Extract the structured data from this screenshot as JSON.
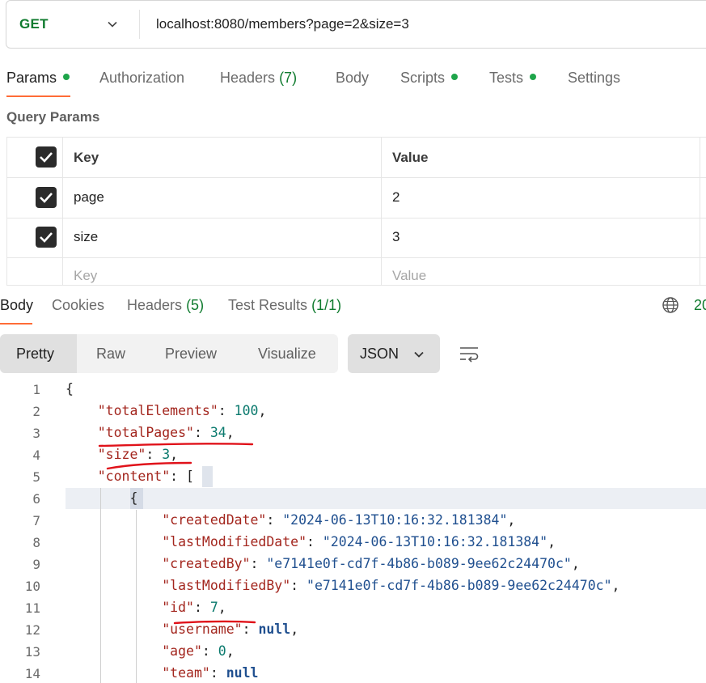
{
  "request": {
    "method": "GET",
    "url": "localhost:8080/members?page=2&size=3",
    "tabs": [
      {
        "label": "Params",
        "dot": true
      },
      {
        "label": "Authorization"
      },
      {
        "label": "Headers",
        "count": "(7)"
      },
      {
        "label": "Body"
      },
      {
        "label": "Scripts",
        "dot": true
      },
      {
        "label": "Tests",
        "dot": true
      },
      {
        "label": "Settings"
      }
    ],
    "query_params_title": "Query Params",
    "table": {
      "header_key": "Key",
      "header_value": "Value",
      "rows": [
        {
          "key": "page",
          "value": "2",
          "checked": true
        },
        {
          "key": "size",
          "value": "3",
          "checked": true
        }
      ],
      "placeholder_key": "Key",
      "placeholder_value": "Value"
    }
  },
  "response": {
    "tabs": [
      {
        "label": "Body"
      },
      {
        "label": "Cookies"
      },
      {
        "label": "Headers",
        "count": "(5)"
      },
      {
        "label": "Test Results",
        "count": "(1/1)"
      }
    ],
    "status_code_partial": "20",
    "view_modes": [
      "Pretty",
      "Raw",
      "Preview",
      "Visualize"
    ],
    "format": "JSON",
    "line_numbers": [
      "1",
      "2",
      "3",
      "4",
      "5",
      "6",
      "7",
      "8",
      "9",
      "10",
      "11",
      "12",
      "13",
      "14"
    ],
    "code": {
      "l1": "{",
      "totalElements_key": "\"totalElements\"",
      "totalElements_val": "100",
      "totalPages_key": "\"totalPages\"",
      "totalPages_val": "34",
      "size_key": "\"size\"",
      "size_val": "3",
      "content_key": "\"content\"",
      "content_open": "[",
      "l6": "{",
      "createdDate_key": "\"createdDate\"",
      "createdDate_val": "\"2024-06-13T10:16:32.181384\"",
      "lastModifiedDate_key": "\"lastModifiedDate\"",
      "lastModifiedDate_val": "\"2024-06-13T10:16:32.181384\"",
      "createdBy_key": "\"createdBy\"",
      "createdBy_val": "\"e7141e0f-cd7f-4b86-b089-9ee62c24470c\"",
      "lastModifiedBy_key": "\"lastModifiedBy\"",
      "lastModifiedBy_val": "\"e7141e0f-cd7f-4b86-b089-9ee62c24470c\"",
      "id_key": "\"id\"",
      "id_val": "7",
      "username_key": "\"username\"",
      "username_val": "null",
      "age_key": "\"age\"",
      "age_val": "0",
      "team_key": "\"team\"",
      "team_val": "null"
    }
  },
  "colors": {
    "accent_underline": "#ff6c37",
    "status_green": "#0f7b2e",
    "annotation_red": "#e0121a"
  },
  "icons": [
    "chevron-down-icon",
    "checkbox-checked-icon",
    "globe-icon",
    "wrap-text-icon"
  ]
}
